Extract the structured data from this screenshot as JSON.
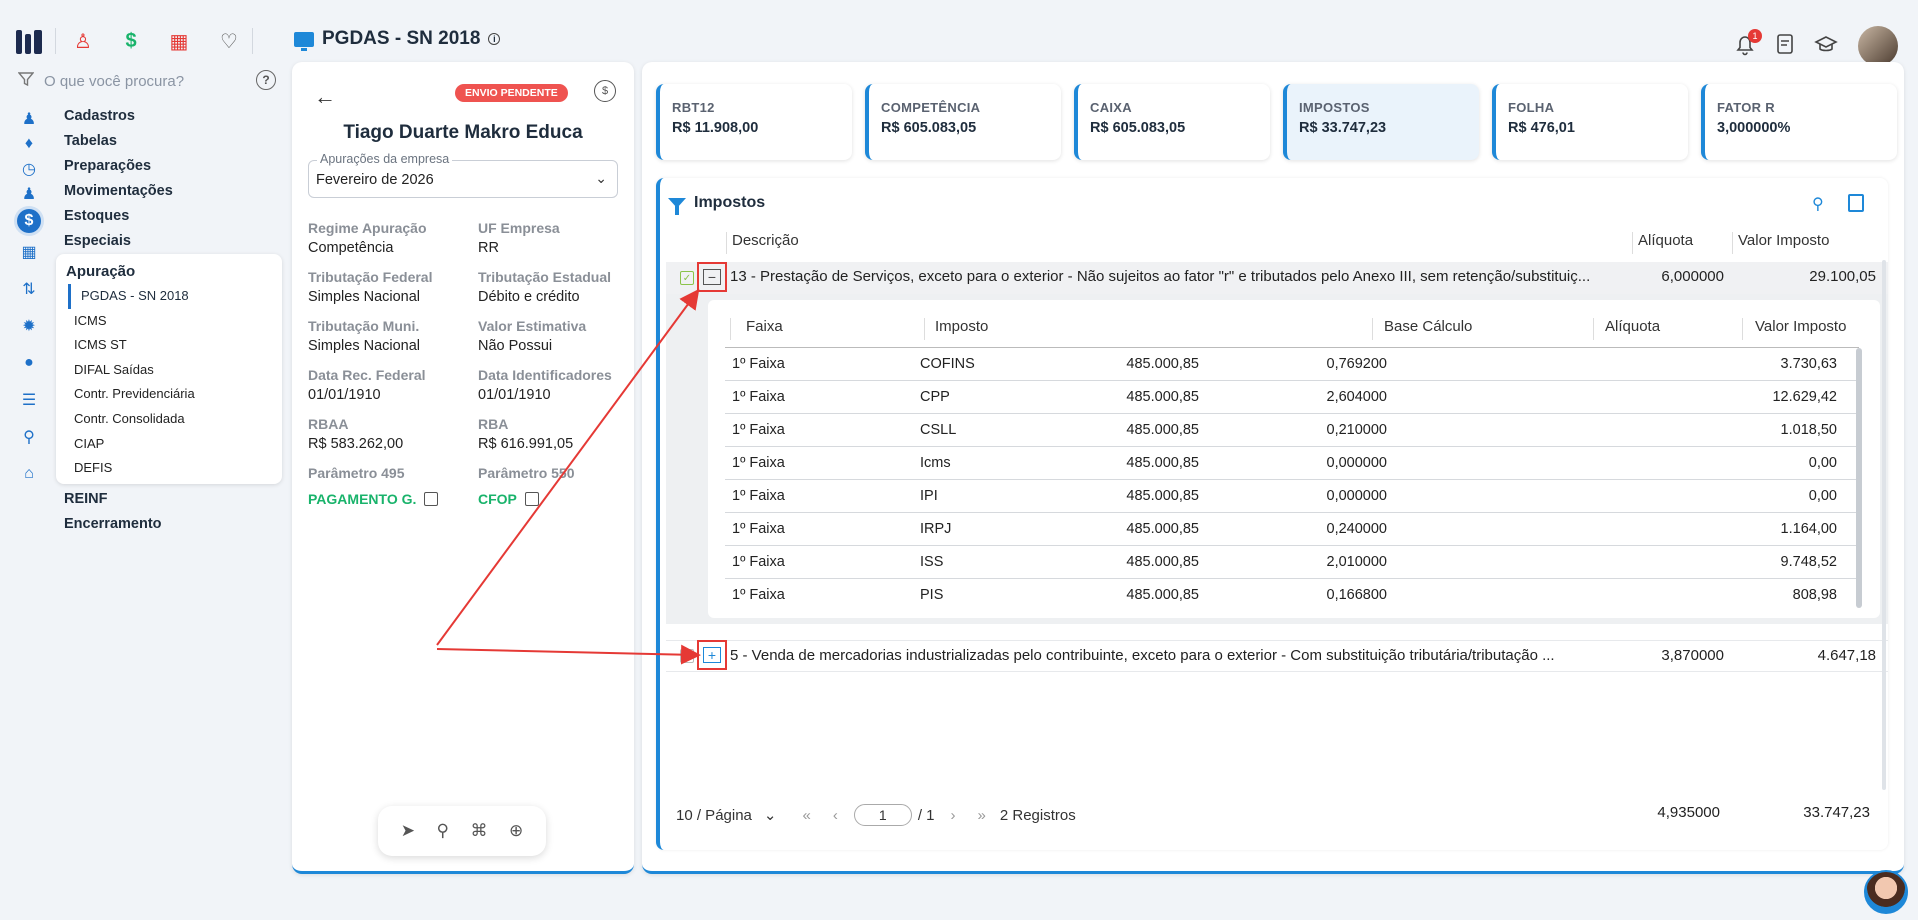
{
  "app": {
    "title": "PGDAS - SN 2018",
    "notifications": "1"
  },
  "top_icons": [
    "people-icon",
    "dollar-icon",
    "calculator-icon",
    "money-bag-icon"
  ],
  "search": {
    "placeholder": "O que você procura?",
    "help": "?"
  },
  "sidebar": {
    "items": [
      "Cadastros",
      "Tabelas",
      "Preparações",
      "Movimentações",
      "Estoques",
      "Especiais"
    ],
    "active_group": "Apuração",
    "sub_items": [
      "PGDAS - SN 2018",
      "ICMS",
      "ICMS ST",
      "DIFAL Saídas",
      "Contr. Previdenciária",
      "Contr. Consolidada",
      "CIAP",
      "DEFIS"
    ],
    "bottom_items": [
      "REINF",
      "Encerramento"
    ]
  },
  "left_panel": {
    "status_badge": "ENVIO PENDENTE",
    "company": "Tiago Duarte Makro Educa",
    "select_label": "Apurações da empresa",
    "select_value": "Fevereiro de 2026",
    "fields": [
      {
        "label": "Regime Apuração",
        "value": "Competência"
      },
      {
        "label": "UF Empresa",
        "value": "RR"
      },
      {
        "label": "Tributação Federal",
        "value": "Simples Nacional"
      },
      {
        "label": "Tributação Estadual",
        "value": "Débito e crédito"
      },
      {
        "label": "Tributação Muni.",
        "value": "Simples Nacional"
      },
      {
        "label": "Valor Estimativa",
        "value": "Não Possui"
      },
      {
        "label": "Data Rec. Federal",
        "value": "01/01/1910"
      },
      {
        "label": "Data Identificadores",
        "value": "01/01/1910"
      },
      {
        "label": "RBAA",
        "value": "R$ 583.262,00"
      },
      {
        "label": "RBA",
        "value": "R$ 616.991,05"
      },
      {
        "label": "Parâmetro 495",
        "value": "PAGAMENTO G."
      },
      {
        "label": "Parâmetro 550",
        "value": "CFOP"
      }
    ]
  },
  "kpis": [
    {
      "label": "RBT12",
      "value": "R$ 11.908,00"
    },
    {
      "label": "COMPETÊNCIA",
      "value": "R$ 605.083,05"
    },
    {
      "label": "CAIXA",
      "value": "R$ 605.083,05"
    },
    {
      "label": "IMPOSTOS",
      "value": "R$ 33.747,23"
    },
    {
      "label": "FOLHA",
      "value": "R$ 476,01"
    },
    {
      "label": "FATOR R",
      "value": "3,000000%"
    }
  ],
  "impostos": {
    "title": "Impostos",
    "headers": {
      "descricao": "Descrição",
      "aliquota": "Alíquota",
      "valor": "Valor Imposto"
    },
    "rows": [
      {
        "expander": "[−]",
        "descricao": "13 - Prestação de Serviços, exceto para o exterior - Não sujeitos ao fator \"r\" e tributados pelo Anexo III, sem retenção/substituiç...",
        "aliquota": "6,000000",
        "valor": "29.100,05"
      },
      {
        "expander": "[+]",
        "descricao": "5 - Venda de mercadorias industrializadas pelo contribuinte, exceto para o exterior - Com substituição tributária/tributação ...",
        "aliquota": "3,870000",
        "valor": "4.647,18"
      }
    ],
    "sub_headers": {
      "faixa": "Faixa",
      "imposto": "Imposto",
      "base": "Base Cálculo",
      "aliquota": "Alíquota",
      "valor": "Valor Imposto"
    },
    "sub_rows": [
      {
        "faixa": "1º Faixa",
        "imposto": "COFINS",
        "base": "485.000,85",
        "aliquota": "0,769200",
        "valor": "3.730,63"
      },
      {
        "faixa": "1º Faixa",
        "imposto": "CPP",
        "base": "485.000,85",
        "aliquota": "2,604000",
        "valor": "12.629,42"
      },
      {
        "faixa": "1º Faixa",
        "imposto": "CSLL",
        "base": "485.000,85",
        "aliquota": "0,210000",
        "valor": "1.018,50"
      },
      {
        "faixa": "1º Faixa",
        "imposto": "Icms",
        "base": "485.000,85",
        "aliquota": "0,000000",
        "valor": "0,00"
      },
      {
        "faixa": "1º Faixa",
        "imposto": "IPI",
        "base": "485.000,85",
        "aliquota": "0,000000",
        "valor": "0,00"
      },
      {
        "faixa": "1º Faixa",
        "imposto": "IRPJ",
        "base": "485.000,85",
        "aliquota": "0,240000",
        "valor": "1.164,00"
      },
      {
        "faixa": "1º Faixa",
        "imposto": "ISS",
        "base": "485.000,85",
        "aliquota": "2,010000",
        "valor": "9.748,52"
      },
      {
        "faixa": "1º Faixa",
        "imposto": "PIS",
        "base": "485.000,85",
        "aliquota": "0,166800",
        "valor": "808,98"
      }
    ],
    "pager": {
      "per_page": "10 / Página",
      "page": "1",
      "total_pages": "/ 1",
      "records": "2 Registros"
    },
    "totals": {
      "aliquota": "4,935000",
      "valor": "33.747,23"
    }
  },
  "colors": {
    "accent": "#1e88d8",
    "danger": "#e53935",
    "success": "#19b36b"
  }
}
